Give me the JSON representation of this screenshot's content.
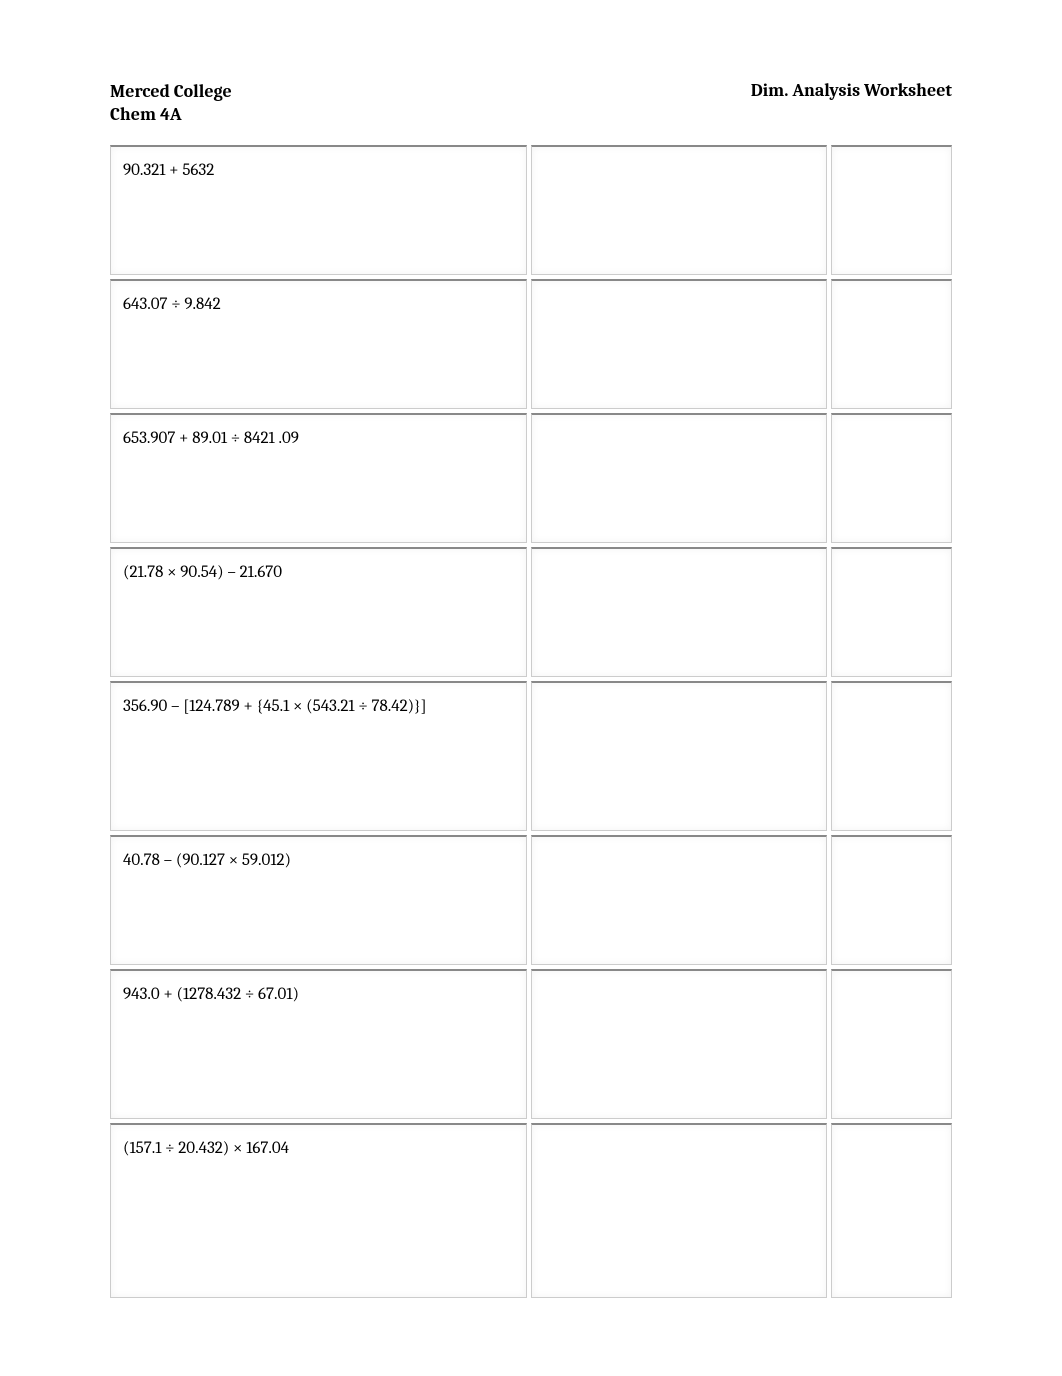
{
  "header": {
    "institution": "Merced College",
    "course": "Chem 4A",
    "worksheet_title": "Dim. Analysis Worksheet"
  },
  "rows": [
    {
      "problem": "90.321 + 5632",
      "height": "row-std"
    },
    {
      "problem": "643.07 ÷ 9.842",
      "height": "row-std"
    },
    {
      "problem": "653.907 + 89.01 ÷ 8421 .09",
      "height": "row-std"
    },
    {
      "problem": "(21.78 × 90.54) – 21.670",
      "height": "row-std"
    },
    {
      "problem": "356.90 – [124.789 + {45.1 × (543.21 ÷ 78.42)}]",
      "height": "row-tall"
    },
    {
      "problem": "40.78 – (90.127 × 59.012)",
      "height": "row-std"
    },
    {
      "problem": "943.0 + (1278.432 ÷ 67.01)",
      "height": "row-tall"
    },
    {
      "problem": "(157.1 ÷ 20.432) × 167.04",
      "height": "row-xtall"
    }
  ]
}
